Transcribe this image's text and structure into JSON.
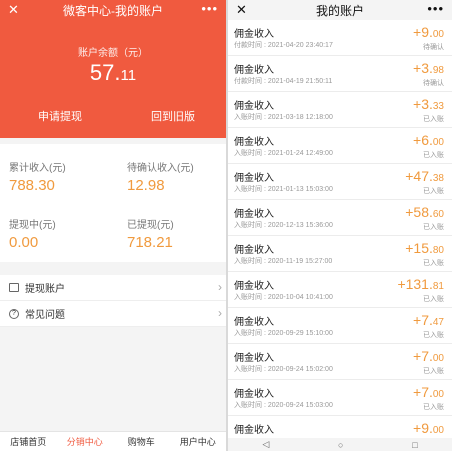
{
  "left": {
    "title": "微客中心-我的账户",
    "balance_label": "账户余额（元）",
    "balance_int": "57.",
    "balance_dec": "11",
    "withdraw_label": "申请提现",
    "oldversion_label": "回到旧版",
    "stats": {
      "total_income_label": "累计收入(元)",
      "total_income": "788.30",
      "pending_label": "待确认收入(元)",
      "pending": "12.98",
      "withdrawing_label": "提现中(元)",
      "withdrawing": "0.00",
      "withdrawn_label": "已提现(元)",
      "withdrawn": "718.21"
    },
    "menu": {
      "account": "提现账户",
      "faq": "常见问题"
    },
    "tabs": [
      "店铺首页",
      "分销中心",
      "购物车",
      "用户中心"
    ]
  },
  "right": {
    "title": "我的账户",
    "records": [
      {
        "title": "佣金收入",
        "time": "付款时间 : 2021-04-20 23:40:17",
        "int": "+9.",
        "dec": "00",
        "status": "待确认"
      },
      {
        "title": "佣金收入",
        "time": "付款时间 : 2021-04-19 21:50:11",
        "int": "+3.",
        "dec": "98",
        "status": "待确认"
      },
      {
        "title": "佣金收入",
        "time": "入账时间 : 2021-03-18 12:18:00",
        "int": "+3.",
        "dec": "33",
        "status": "已入账"
      },
      {
        "title": "佣金收入",
        "time": "入账时间 : 2021-01-24 12:49:00",
        "int": "+6.",
        "dec": "00",
        "status": "已入账"
      },
      {
        "title": "佣金收入",
        "time": "入账时间 : 2021-01-13 15:03:00",
        "int": "+47.",
        "dec": "38",
        "status": "已入账"
      },
      {
        "title": "佣金收入",
        "time": "入账时间 : 2020-12-13 15:36:00",
        "int": "+58.",
        "dec": "60",
        "status": "已入账"
      },
      {
        "title": "佣金收入",
        "time": "入账时间 : 2020-11-19 15:27:00",
        "int": "+15.",
        "dec": "80",
        "status": "已入账"
      },
      {
        "title": "佣金收入",
        "time": "入账时间 : 2020-10-04 10:41:00",
        "int": "+131.",
        "dec": "81",
        "status": "已入账"
      },
      {
        "title": "佣金收入",
        "time": "入账时间 : 2020-09-29 15:10:00",
        "int": "+7.",
        "dec": "47",
        "status": "已入账"
      },
      {
        "title": "佣金收入",
        "time": "入账时间 : 2020-09-24 15:02:00",
        "int": "+7.",
        "dec": "00",
        "status": "已入账"
      },
      {
        "title": "佣金收入",
        "time": "入账时间 : 2020-09-24 15:03:00",
        "int": "+7.",
        "dec": "00",
        "status": "已入账"
      },
      {
        "title": "佣金收入",
        "time": "",
        "int": "+9.",
        "dec": "00",
        "status": ""
      }
    ]
  },
  "icons": {
    "back": "back-arrow-icon",
    "more": "more-icon",
    "card": "card-icon",
    "faq": "question-icon",
    "chevron": "chevron-right-icon"
  },
  "colors": {
    "accent": "#f05a3f",
    "amount": "#f09a3e"
  }
}
